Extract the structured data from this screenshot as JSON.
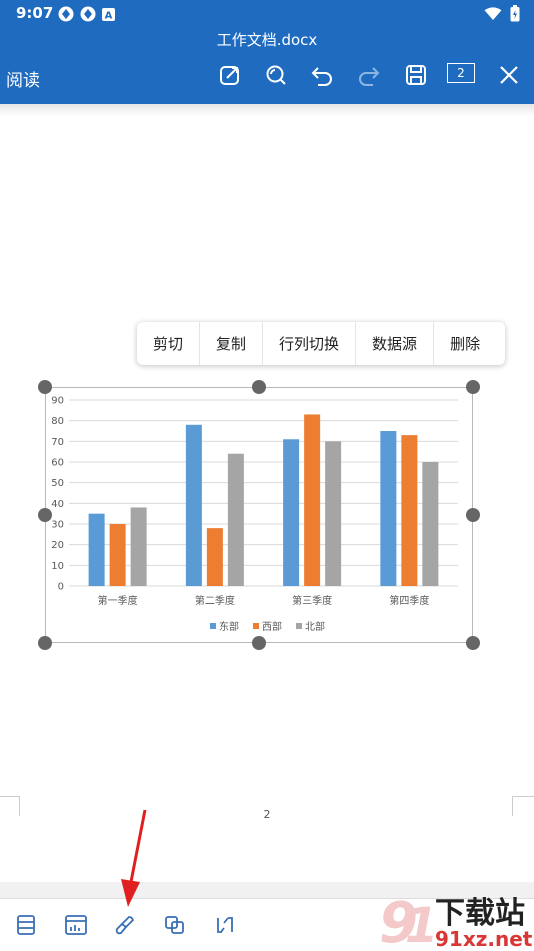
{
  "status": {
    "time": "9:07"
  },
  "header": {
    "doc_title": "工作文档.docx",
    "mode_label": "阅读",
    "page_indicator": "2"
  },
  "context_menu": {
    "items": [
      "剪切",
      "复制",
      "行列切换",
      "数据源",
      "删除"
    ]
  },
  "chart_data": {
    "type": "bar",
    "categories": [
      "第一季度",
      "第二季度",
      "第三季度",
      "第四季度"
    ],
    "series": [
      {
        "name": "东部",
        "color": "#5b9bd5",
        "values": [
          35,
          78,
          71,
          75
        ]
      },
      {
        "name": "西部",
        "color": "#ed7d31",
        "values": [
          30,
          28,
          83,
          73
        ]
      },
      {
        "name": "北部",
        "color": "#a5a5a5",
        "values": [
          38,
          64,
          70,
          60
        ]
      }
    ],
    "yticks": [
      0,
      10,
      20,
      30,
      40,
      50,
      60,
      70,
      80,
      90
    ],
    "ylim": [
      0,
      90
    ],
    "grid": true,
    "legend": "bottom"
  },
  "document": {
    "page_number": "2"
  },
  "watermark": {
    "text_top": "下载站",
    "text_bottom": "91xz.net"
  },
  "colors": {
    "header": "#1f6bc0",
    "annotation_arrow": "#e02020"
  }
}
